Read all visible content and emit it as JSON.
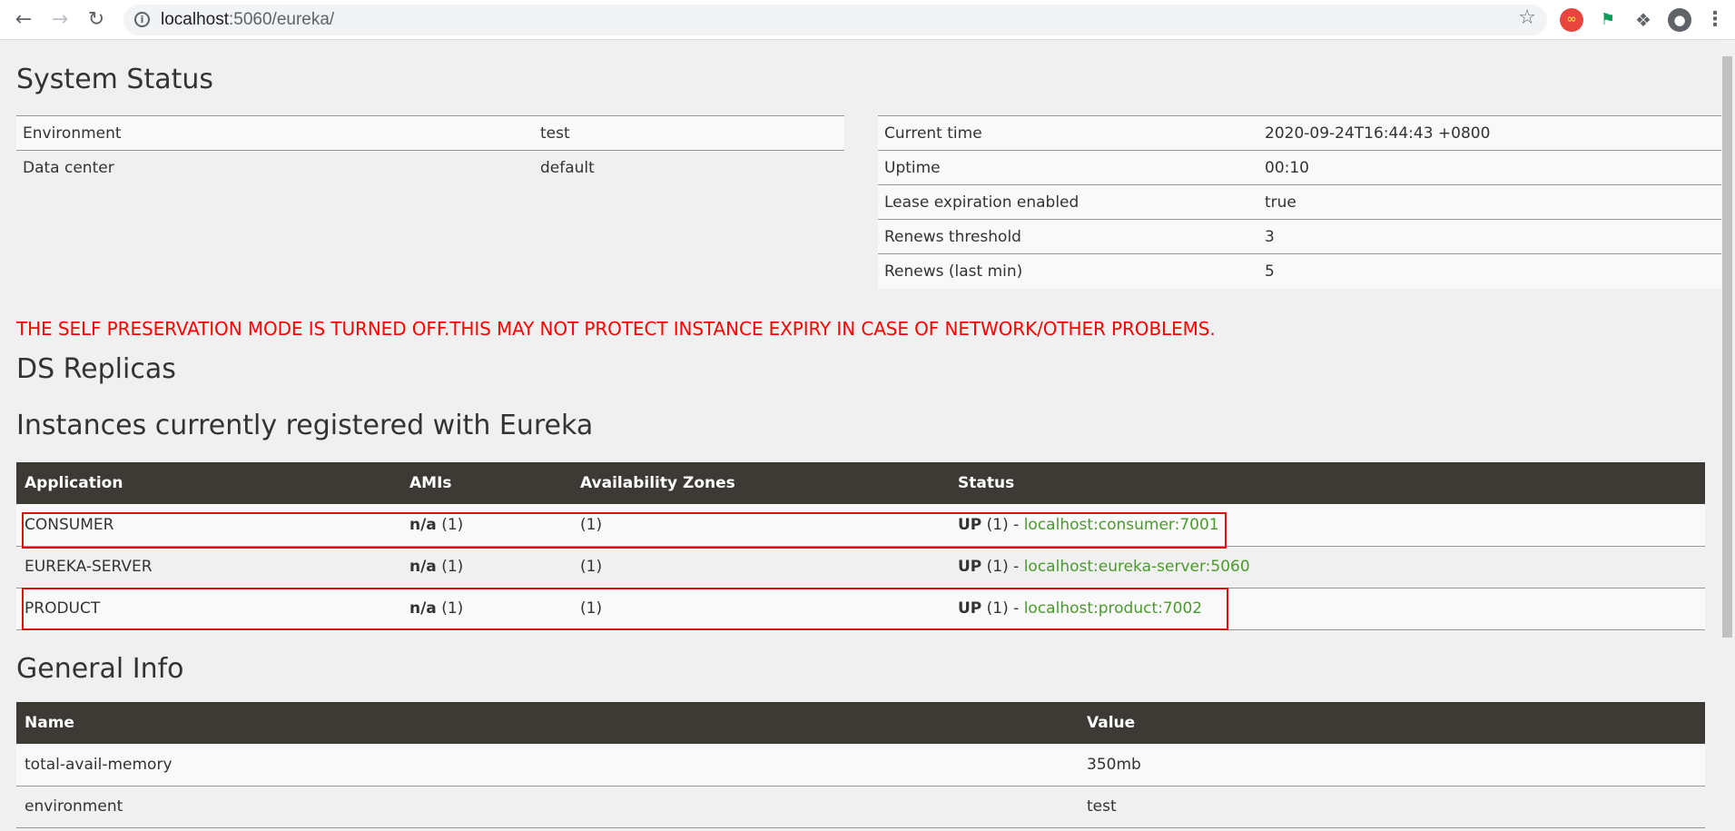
{
  "browser": {
    "url_host": "localhost",
    "url_path": ":5060/eureka/",
    "icons": [
      "back-icon",
      "forward-icon",
      "reload-icon",
      "info-icon",
      "star-icon",
      "extension-infinity-icon",
      "extension-flag-icon",
      "extensions-puzzle-icon",
      "profile-avatar-icon",
      "menu-kebab-icon"
    ]
  },
  "system_status": {
    "title": "System Status",
    "left": [
      {
        "key": "Environment",
        "value": "test"
      },
      {
        "key": "Data center",
        "value": "default"
      }
    ],
    "right": [
      {
        "key": "Current time",
        "value": "2020-09-24T16:44:43 +0800"
      },
      {
        "key": "Uptime",
        "value": "00:10"
      },
      {
        "key": "Lease expiration enabled",
        "value": "true"
      },
      {
        "key": "Renews threshold",
        "value": "3"
      },
      {
        "key": "Renews (last min)",
        "value": "5"
      }
    ]
  },
  "warning": "THE SELF PRESERVATION MODE IS TURNED OFF.THIS MAY NOT PROTECT INSTANCE EXPIRY IN CASE OF NETWORK/OTHER PROBLEMS.",
  "replicas": {
    "title": "DS Replicas"
  },
  "instances": {
    "title": "Instances currently registered with Eureka",
    "columns": [
      "Application",
      "AMIs",
      "Availability Zones",
      "Status"
    ],
    "rows": [
      {
        "application": "CONSUMER",
        "ami": "n/a",
        "ami_count": "(1)",
        "zones": "(1)",
        "status": "UP",
        "status_count": "(1) -",
        "link": "localhost:consumer:7001"
      },
      {
        "application": "EUREKA-SERVER",
        "ami": "n/a",
        "ami_count": "(1)",
        "zones": "(1)",
        "status": "UP",
        "status_count": "(1) -",
        "link": "localhost:eureka-server:5060"
      },
      {
        "application": "PRODUCT",
        "ami": "n/a",
        "ami_count": "(1)",
        "zones": "(1)",
        "status": "UP",
        "status_count": "(1) -",
        "link": "localhost:product:7002"
      }
    ]
  },
  "general_info": {
    "title": "General Info",
    "columns": [
      "Name",
      "Value"
    ],
    "rows": [
      {
        "name": "total-avail-memory",
        "value": "350mb"
      },
      {
        "name": "environment",
        "value": "test"
      }
    ]
  },
  "colors": {
    "warning": "#ff0000",
    "table_header": "#3d3a36",
    "link": "#4a9b2d",
    "highlight_box": "#e01010"
  }
}
